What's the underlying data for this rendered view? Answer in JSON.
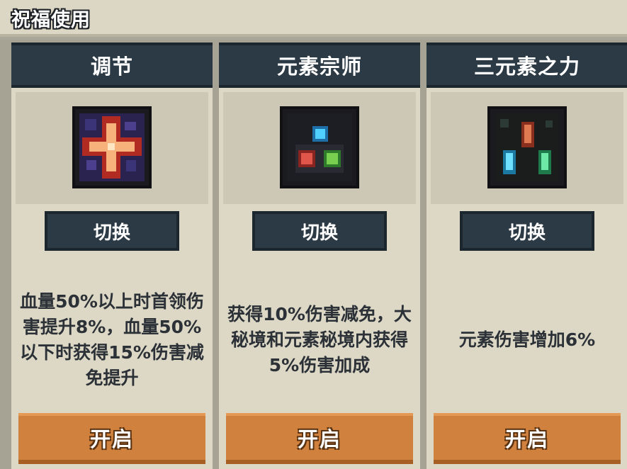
{
  "window": {
    "title": "祝福使用"
  },
  "cards": [
    {
      "name": "调节",
      "icon": "orange-cross-icon",
      "switch_label": "切换",
      "description": "血量50%以上时首领伤害提升8%，血量50%以下时获得15%伤害减免提升",
      "open_label": "开启"
    },
    {
      "name": "元素宗师",
      "icon": "three-element-orbs-icon",
      "switch_label": "切换",
      "description": "获得10%伤害减免，大秘境和元素秘境内获得5%伤害加成",
      "open_label": "开启"
    },
    {
      "name": "三元素之力",
      "icon": "three-crystals-icon",
      "switch_label": "切换",
      "description": "元素伤害增加6%",
      "open_label": "开启"
    }
  ],
  "colors": {
    "header_bg": "#2b3a45",
    "card_bg": "#ddd8c5",
    "open_button": "#d0813d"
  }
}
